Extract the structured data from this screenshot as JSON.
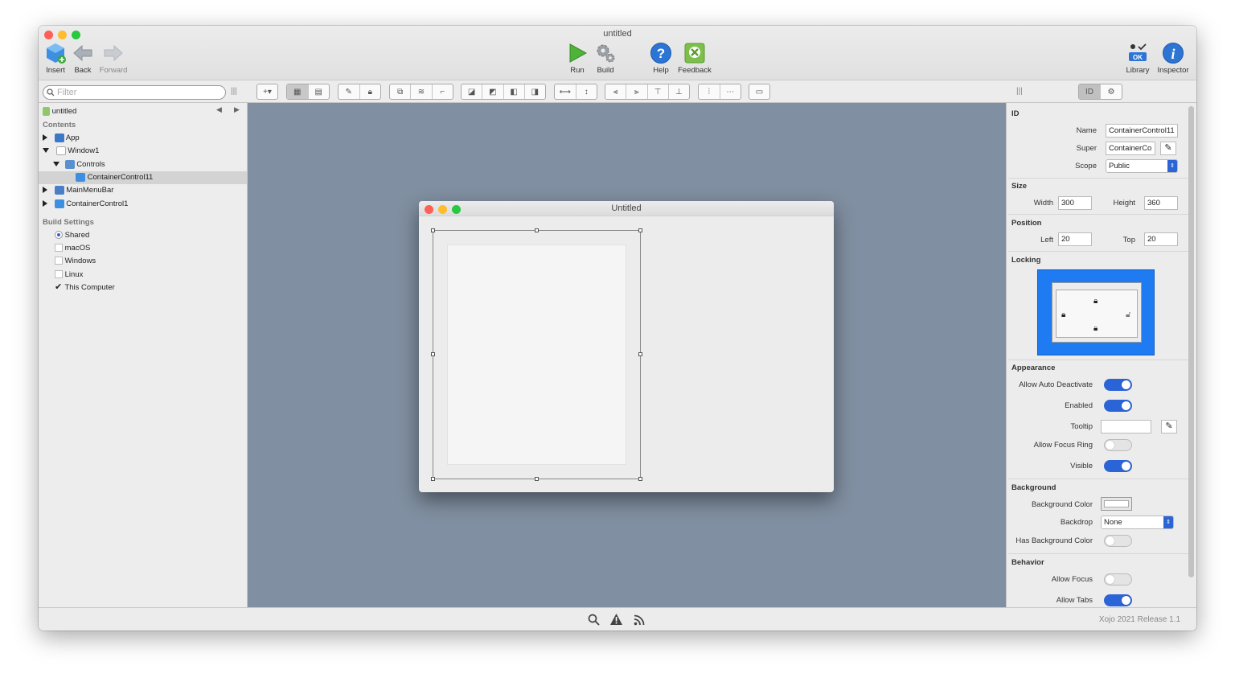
{
  "window": {
    "title": "untitled"
  },
  "toolbar": {
    "insert": "Insert",
    "back": "Back",
    "forward": "Forward",
    "run": "Run",
    "build": "Build",
    "help": "Help",
    "feedback": "Feedback",
    "library": "Library",
    "inspector": "Inspector"
  },
  "navigator": {
    "filter_placeholder": "Filter",
    "project": "untitled",
    "contents_header": "Contents",
    "items": {
      "app": "App",
      "window1": "Window1",
      "controls": "Controls",
      "container_control11": "ContainerControl11",
      "main_menu_bar": "MainMenuBar",
      "container_control1": "ContainerControl1"
    },
    "build_header": "Build Settings",
    "build_items": [
      "Shared",
      "macOS",
      "Windows",
      "Linux",
      "This Computer"
    ]
  },
  "designer": {
    "inner_title": "Untitled"
  },
  "inspector": {
    "id_header": "ID",
    "name_label": "Name",
    "name_value": "ContainerControl11",
    "super_label": "Super",
    "super_value": "ContainerCo",
    "scope_label": "Scope",
    "scope_value": "Public",
    "size_header": "Size",
    "width_label": "Width",
    "width_value": "300",
    "height_label": "Height",
    "height_value": "360",
    "position_header": "Position",
    "left_label": "Left",
    "left_value": "20",
    "top_label": "Top",
    "top_value": "20",
    "locking_header": "Locking",
    "appearance_header": "Appearance",
    "allow_auto_deactivate": "Allow Auto Deactivate",
    "enabled": "Enabled",
    "tooltip": "Tooltip",
    "allow_focus_ring": "Allow Focus Ring",
    "visible": "Visible",
    "background_header": "Background",
    "background_color": "Background Color",
    "backdrop": "Backdrop",
    "backdrop_value": "None",
    "has_background_color": "Has Background Color",
    "behavior_header": "Behavior",
    "allow_focus": "Allow Focus",
    "allow_tabs": "Allow Tabs"
  },
  "status": {
    "version": "Xojo 2021 Release 1.1"
  },
  "colors": {
    "accent": "#2b64d6",
    "canvas": "#808fa1",
    "locking_bg": "#1e7bf2"
  }
}
